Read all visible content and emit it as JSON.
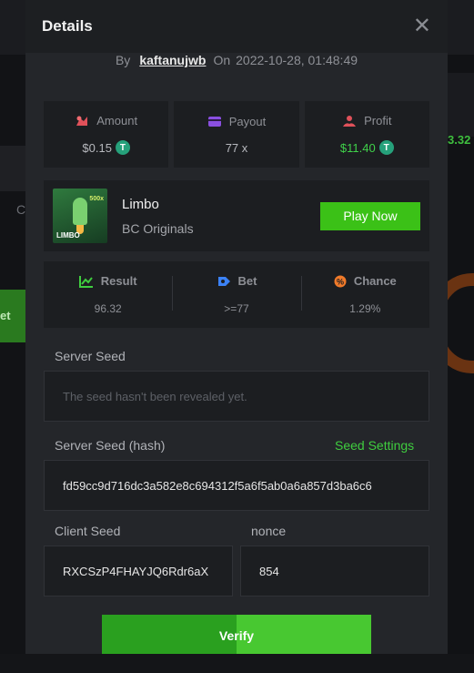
{
  "background": {
    "left_button_label": "et",
    "left_letter": "C",
    "right_amount": "3.32"
  },
  "modal": {
    "title": "Details",
    "close_glyph": "✕"
  },
  "byline": {
    "by_label": "By",
    "username": "kaftanujwb",
    "on_label": "On",
    "date": "2022-10-28, 01:48:49"
  },
  "stats": {
    "amount": {
      "label": "Amount",
      "value": "$0.15",
      "icon": "amount-icon"
    },
    "payout": {
      "label": "Payout",
      "value": "77 x",
      "icon": "payout-icon"
    },
    "profit": {
      "label": "Profit",
      "value": "$11.40",
      "icon": "profit-icon"
    },
    "coin_glyph": "T"
  },
  "game": {
    "name": "Limbo",
    "provider": "BC Originals",
    "play_label": "Play Now",
    "thumb_tag": "LIMBO",
    "thumb_mult": "500x"
  },
  "result": {
    "result": {
      "label": "Result",
      "value": "96.32"
    },
    "bet": {
      "label": "Bet",
      "value": ">=77"
    },
    "chance": {
      "label": "Chance",
      "value": "1.29%"
    }
  },
  "server_seed": {
    "label": "Server Seed",
    "placeholder": "The seed hasn't been revealed yet."
  },
  "server_seed_hash": {
    "label": "Server Seed (hash)",
    "settings_label": "Seed Settings",
    "value": "fd59cc9d716dc3a582e8c694312f5a6f5ab0a6a857d3ba6c6"
  },
  "client_seed": {
    "label": "Client Seed",
    "value": "RXCSzP4FHAYJQ6Rdr6aX"
  },
  "nonce": {
    "label": "nonce",
    "value": "854"
  },
  "verify_label": "Verify",
  "colors": {
    "accent_green": "#3bc117",
    "profit_green": "#3fd14a",
    "tether": "#26a17b"
  }
}
